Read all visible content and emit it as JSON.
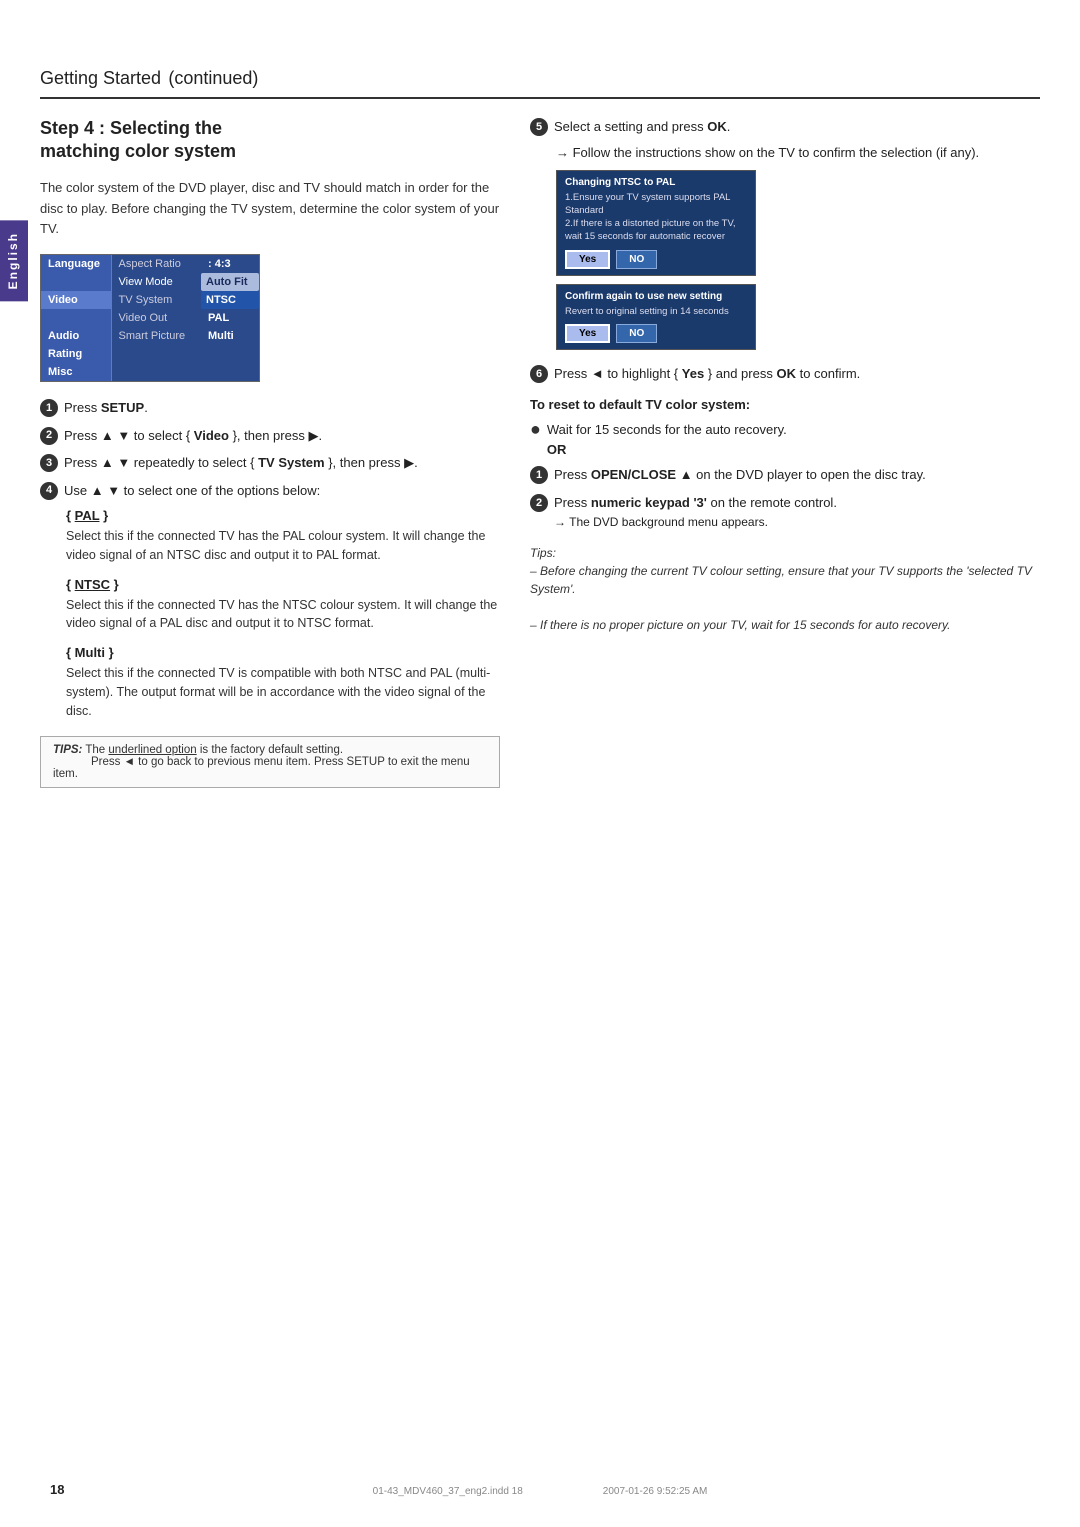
{
  "page": {
    "title": "Getting Started",
    "title_cont": "continued",
    "page_number": "18",
    "footer_left": "01-43_MDV460_37_eng2.indd  18",
    "footer_right": "2007-01-26  9:52:25 AM"
  },
  "side_tab": {
    "label": "English"
  },
  "step": {
    "heading_line1": "Step 4 : Selecting the",
    "heading_line2": "matching color system"
  },
  "intro_text": "The color system of the DVD player, disc and TV should match in order for the disc to play. Before changing the TV system, determine the color system of your TV.",
  "menu": {
    "rows": [
      {
        "left": "Language",
        "label": "Aspect Ratio",
        "value": ": 4:3",
        "highlight": false,
        "active_side": false
      },
      {
        "left": "",
        "label": "View Mode",
        "value": "Auto Fit",
        "highlight": true,
        "active_side": false
      },
      {
        "left": "Video",
        "label": "TV System",
        "value": "NTSC",
        "highlight": false,
        "active_side": true,
        "active_val": false
      },
      {
        "left": "",
        "label": "Video Out",
        "value": "PAL",
        "highlight": false,
        "active_side": false,
        "active_val": true
      },
      {
        "left": "Audio",
        "label": "Smart Picture",
        "value": "Multi",
        "highlight": false,
        "active_side": false
      },
      {
        "left": "Rating",
        "label": "",
        "value": "",
        "highlight": false,
        "active_side": false
      },
      {
        "left": "Misc",
        "label": "",
        "value": "",
        "highlight": false,
        "active_side": false
      }
    ]
  },
  "left_steps": [
    {
      "num": "1",
      "text": "Press ",
      "bold": "SETUP",
      "rest": "."
    },
    {
      "num": "2",
      "text": "Press ▲ ▼ to select { ",
      "bold": "Video",
      "rest": " }, then press ▶."
    },
    {
      "num": "3",
      "text": "Press ▲ ▼ repeatedly to select { ",
      "bold": "TV System",
      "rest": " }, then press ▶."
    },
    {
      "num": "4",
      "text": "Use ▲ ▼ to select one of the options below:"
    }
  ],
  "options": [
    {
      "title": "{ PAL }",
      "underline": "PAL",
      "desc": "Select this if the connected TV has the PAL colour system. It will change the video signal of an NTSC disc and output it to PAL format."
    },
    {
      "title": "{ NTSC }",
      "underline": "NTSC",
      "desc": "Select this if the connected TV has the NTSC colour system. It will change the video signal of a PAL disc and output it to NTSC format."
    },
    {
      "title": "{ Multi }",
      "underline": "",
      "desc": "Select this if the connected TV is compatible with both NTSC and PAL (multi-system). The output format will be in accordance with the video signal of the disc."
    }
  ],
  "tips_box": {
    "label": "TIPS:",
    "line1": "The underlined option is the factory default setting.",
    "line2": "Press ◄ to go back to previous menu item. Press SETUP to exit the menu item."
  },
  "right_steps": [
    {
      "num": "5",
      "text": "Select a setting and press ",
      "bold": "OK",
      "rest": ".",
      "has_arrow": false
    },
    {
      "sub": "→ Follow the instructions show on the TV to confirm the selection (if any)."
    }
  ],
  "dialog1": {
    "title": "Changing NTSC to PAL",
    "line1": "1.Ensure your TV system supports PAL Standard",
    "line2": "2.If there is a distorted picture on the TV, wait 15 seconds for automatic recover",
    "btn_yes": "Yes",
    "btn_no": "NO"
  },
  "dialog2": {
    "title": "Confirm again to use new setting",
    "line1": "Revert to original setting in 14 seconds",
    "btn_yes": "Yes",
    "btn_no": "NO"
  },
  "step6": {
    "text": "Press ◄ to highlight { ",
    "bold_yes": "Yes",
    "rest": " } and press ",
    "bold_ok": "OK",
    "rest2": " to confirm."
  },
  "reset_heading": "To reset to default TV color system:",
  "reset_bullet": {
    "text": "Wait for 15 seconds for the auto recovery."
  },
  "or_text": "OR",
  "reset_steps": [
    {
      "num": "1",
      "text": "Press ",
      "bold": "OPEN/CLOSE ▲",
      "rest": " on the DVD player to open the disc tray."
    },
    {
      "num": "2",
      "text": "Press ",
      "bold": "numeric keypad '3'",
      "rest": " on the remote control.",
      "sub": "→ The DVD background menu appears."
    }
  ],
  "tips_italic": {
    "line1": "Tips:",
    "line2": "– Before changing the current TV colour setting, ensure that your TV supports the 'selected TV System'.",
    "line3": "– If there is no proper picture on your TV, wait for 15 seconds for auto recovery."
  }
}
